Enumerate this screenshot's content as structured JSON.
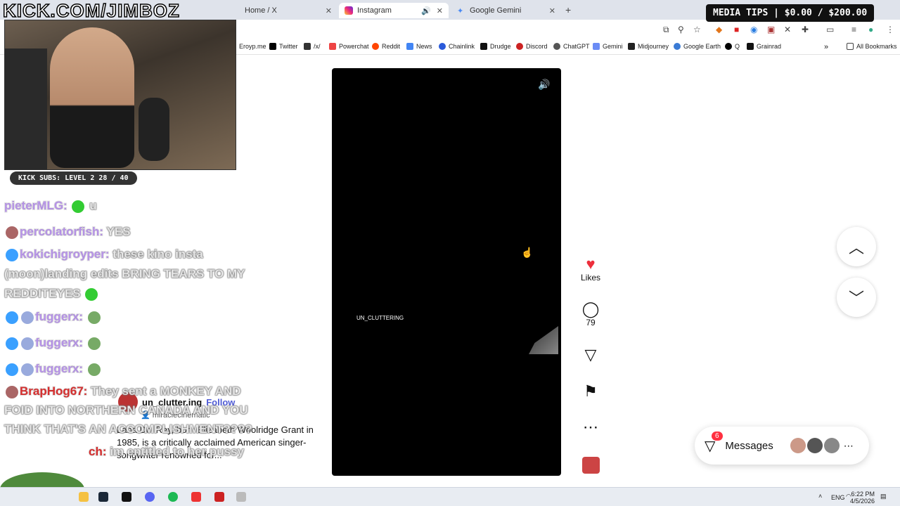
{
  "browser": {
    "tabs": [
      {
        "label": "Home / X"
      },
      {
        "label": "Instagram"
      },
      {
        "label": "Google Gemini"
      }
    ],
    "new_tab": "+",
    "bookmarks": [
      "Eroyp.me",
      "Twitter",
      "/x/",
      "Powerchat",
      "Reddit",
      "News",
      "Chainlink",
      "Drudge",
      "Discord",
      "ChatGPT",
      "Gemini",
      "Midjourney",
      "Google Earth",
      "Q",
      "Grainrad"
    ],
    "all_bookmarks": "All Bookmarks"
  },
  "reel": {
    "caption_overlay": "UN_CLUTTERING",
    "username": "un_clutter.ing",
    "follow": "Follow",
    "audio": "miraclecinematic",
    "description": "Lana Del Rey, born Elizabeth Woolridge Grant in 1985, is a critically acclaimed American singer-songwriter renowned for...",
    "likes_label": "Likes",
    "comments_count": "79"
  },
  "messages": {
    "label": "Messages",
    "badge": "6"
  },
  "overlay": {
    "channel": "KICK.COM/JIMBOZ",
    "subs": "KICK SUBS: LEVEL 2 28 / 40",
    "media_tips": "MEDIA TIPS | $0.00 / $200.00",
    "chat": [
      {
        "name": "pieterMLG:",
        "msg": "u"
      },
      {
        "name": "percolatorfish:",
        "msg": "YES"
      },
      {
        "name": "kokichigroyper:",
        "msg": "these kino insta (moon)landing edits BRING TEARS TO MY REDDITEYES"
      },
      {
        "name": "fuggerx:",
        "msg": ""
      },
      {
        "name": "fuggerx:",
        "msg": ""
      },
      {
        "name": "fuggerx:",
        "msg": ""
      },
      {
        "name": "BrapHog67:",
        "msg": "They sent a MONKEY AND FOID INTO NORTHERN CANADA AND YOU THINK THAT'S AN ACCOMPLISHMENT????"
      },
      {
        "name": "ch:",
        "msg": "im entitled to her pussy"
      }
    ]
  },
  "taskbar": {
    "lang": "ENG",
    "time": "6:22 PM",
    "date": "4/5/2026"
  }
}
